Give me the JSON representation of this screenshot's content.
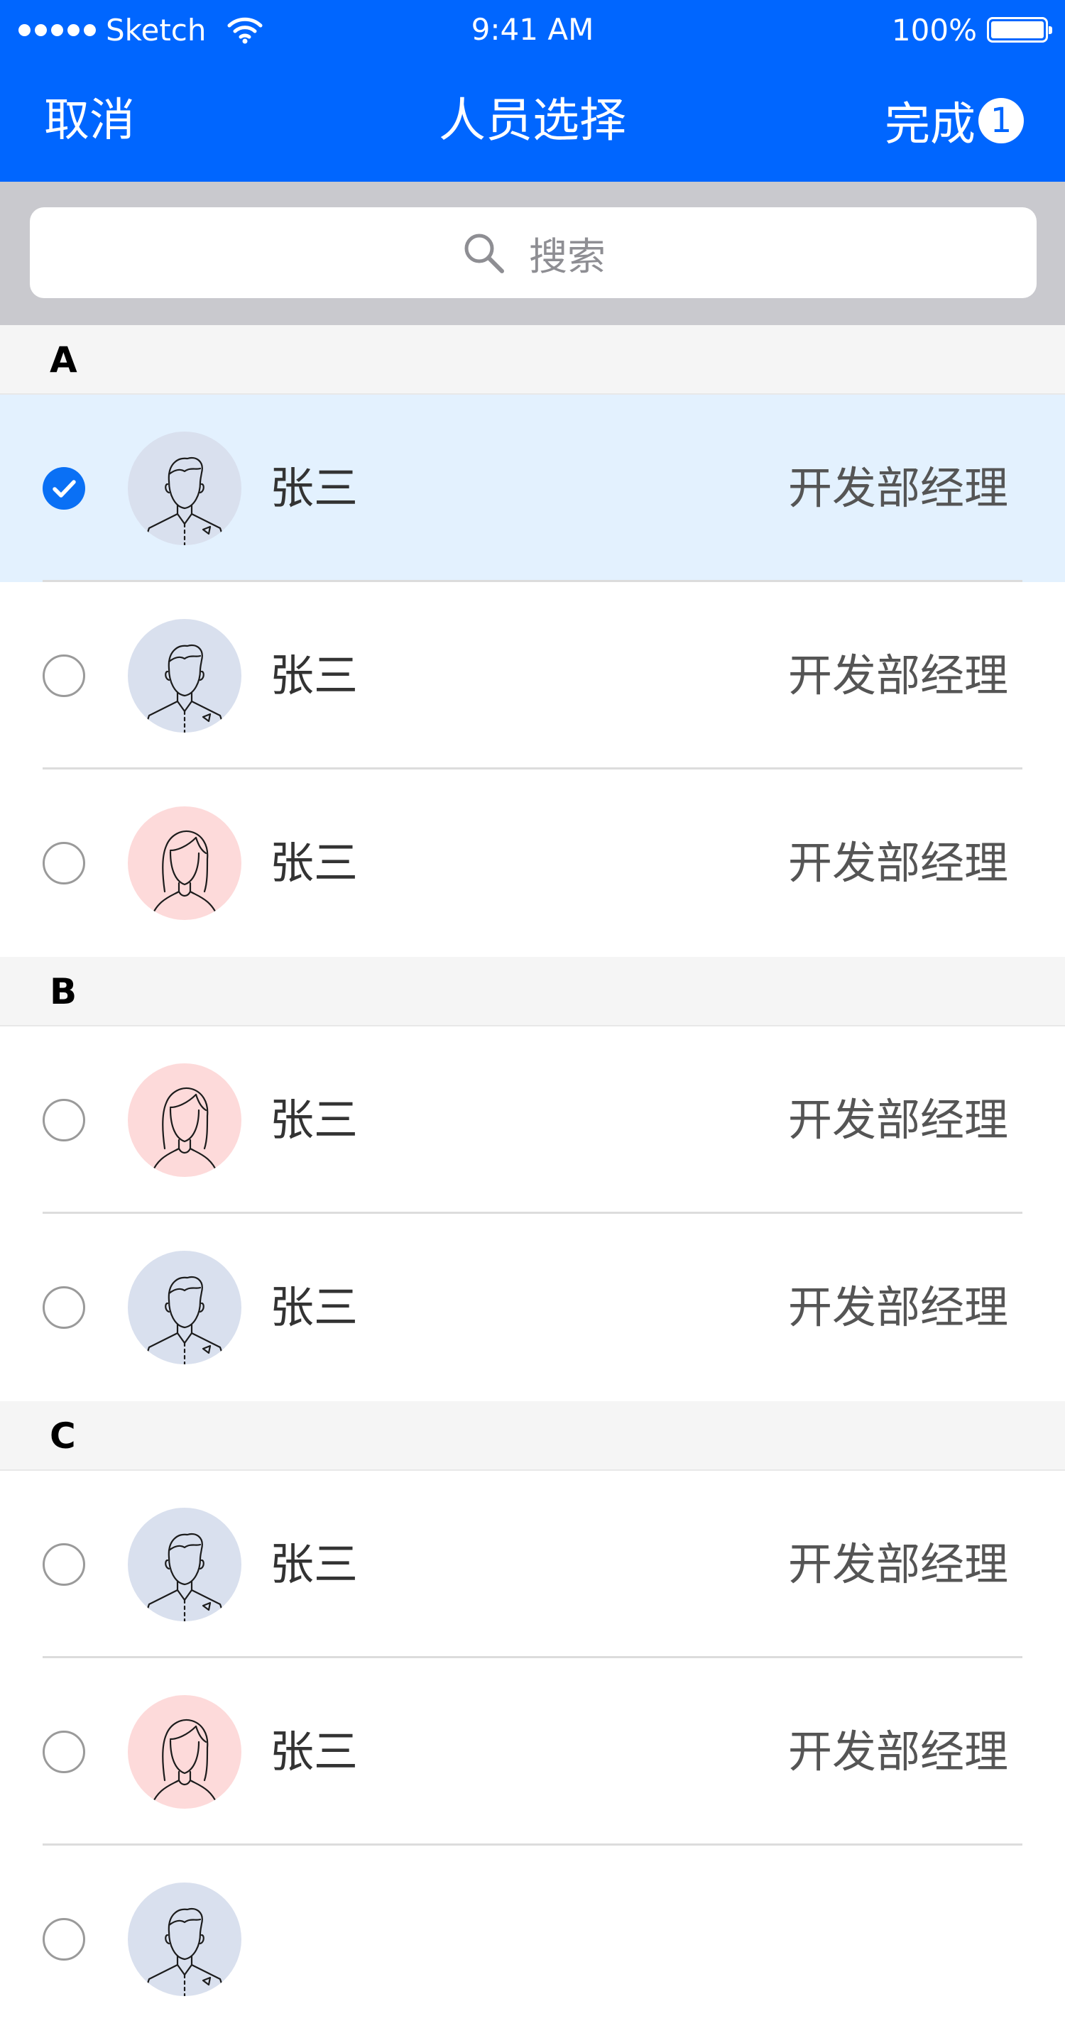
{
  "status_bar": {
    "carrier": "Sketch",
    "time": "9:41 AM",
    "battery": "100%"
  },
  "nav": {
    "cancel_label": "取消",
    "title": "人员选择",
    "done_label": "完成",
    "done_count": "1"
  },
  "search": {
    "placeholder": "搜索"
  },
  "colors": {
    "primary": "#0066FF",
    "selected_row": "#E3F1FE",
    "male_avatar_bg": "#D9E0EE",
    "female_avatar_bg": "#FDDADA"
  },
  "sections": [
    {
      "letter": "A",
      "items": [
        {
          "name": "张三",
          "role": "开发部经理",
          "avatar": "male-avatar-icon",
          "selected": true
        },
        {
          "name": "张三",
          "role": "开发部经理",
          "avatar": "male-avatar-icon",
          "selected": false
        },
        {
          "name": "张三",
          "role": "开发部经理",
          "avatar": "female-avatar-icon",
          "selected": false
        }
      ]
    },
    {
      "letter": "B",
      "items": [
        {
          "name": "张三",
          "role": "开发部经理",
          "avatar": "female-avatar-icon",
          "selected": false
        },
        {
          "name": "张三",
          "role": "开发部经理",
          "avatar": "male-avatar-icon",
          "selected": false
        }
      ]
    },
    {
      "letter": "C",
      "items": [
        {
          "name": "张三",
          "role": "开发部经理",
          "avatar": "male-avatar-icon",
          "selected": false
        },
        {
          "name": "张三",
          "role": "开发部经理",
          "avatar": "female-avatar-icon",
          "selected": false
        },
        {
          "name": "",
          "role": "",
          "avatar": "male-avatar-icon",
          "selected": false
        }
      ]
    }
  ]
}
